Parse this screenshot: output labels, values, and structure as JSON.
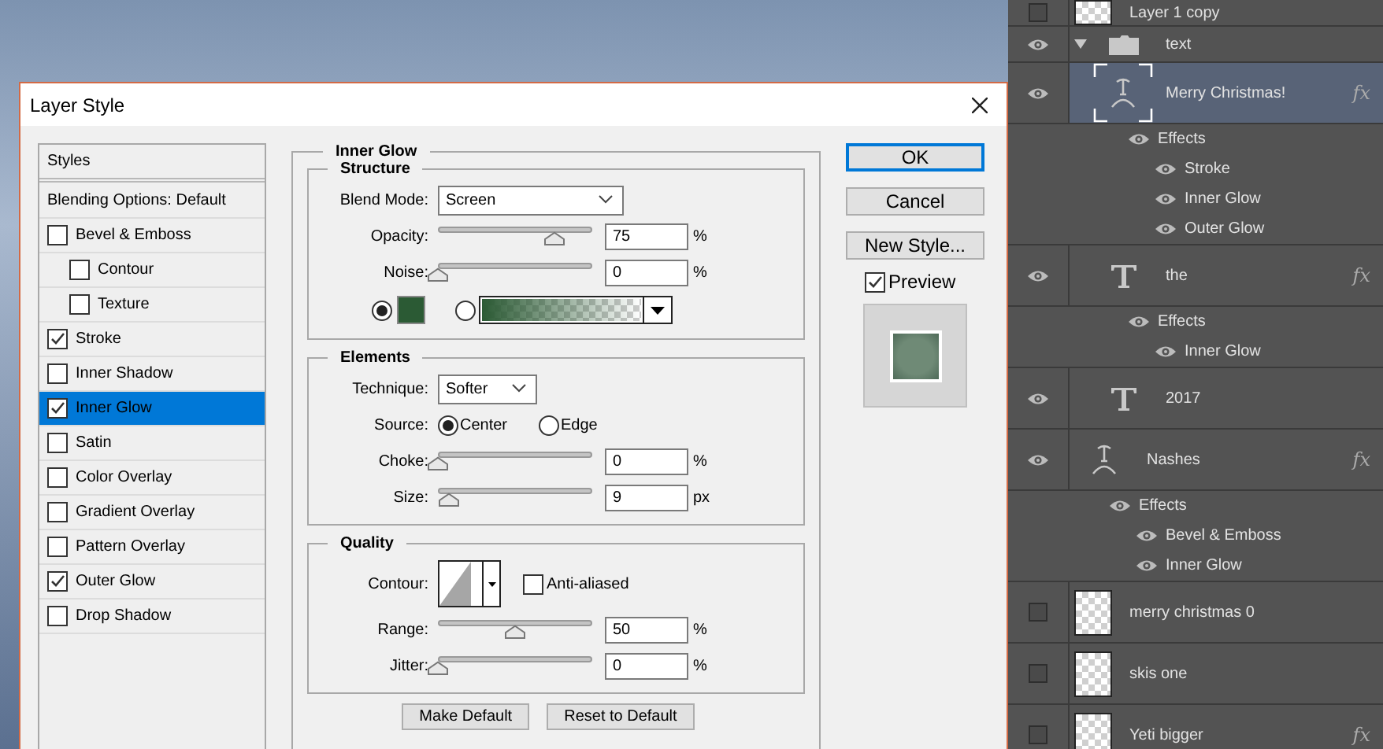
{
  "dialog": {
    "title": "Layer Style",
    "styles": [
      {
        "label": "Styles",
        "kind": "header",
        "selected": false
      },
      {
        "label": "Blending Options: Default",
        "kind": "header",
        "selected": false
      },
      {
        "label": "Bevel & Emboss",
        "kind": "checkbox",
        "checked": false,
        "selected": false,
        "children": [
          {
            "label": "Contour",
            "kind": "checkbox",
            "checked": false,
            "selected": false
          },
          {
            "label": "Texture",
            "kind": "checkbox",
            "checked": false,
            "selected": false
          }
        ]
      },
      {
        "label": "Stroke",
        "kind": "checkbox",
        "checked": true,
        "selected": false
      },
      {
        "label": "Inner Shadow",
        "kind": "checkbox",
        "checked": false,
        "selected": false
      },
      {
        "label": "Inner Glow",
        "kind": "checkbox",
        "checked": true,
        "selected": true
      },
      {
        "label": "Satin",
        "kind": "checkbox",
        "checked": false,
        "selected": false
      },
      {
        "label": "Color Overlay",
        "kind": "checkbox",
        "checked": false,
        "selected": false
      },
      {
        "label": "Gradient Overlay",
        "kind": "checkbox",
        "checked": false,
        "selected": false
      },
      {
        "label": "Pattern Overlay",
        "kind": "checkbox",
        "checked": false,
        "selected": false
      },
      {
        "label": "Outer Glow",
        "kind": "checkbox",
        "checked": true,
        "selected": false
      },
      {
        "label": "Drop Shadow",
        "kind": "checkbox",
        "checked": false,
        "selected": false
      }
    ],
    "panel": {
      "title": "Inner Glow",
      "structure": {
        "title": "Structure",
        "blend_mode": {
          "label": "Blend Mode:",
          "value": "Screen"
        },
        "sliders": [
          {
            "label": "Opacity:",
            "level": 0.75,
            "value": "75",
            "unit": "%"
          },
          {
            "label": "Noise:",
            "level": 0,
            "value": "0",
            "unit": "%"
          }
        ],
        "fill": [
          {
            "kind": "color",
            "selected": true,
            "color": "#2b5a34"
          },
          {
            "kind": "gradient",
            "selected": false,
            "color": "#2b5a34"
          }
        ]
      },
      "elements": {
        "title": "Elements",
        "technique": {
          "label": "Technique:",
          "value": "Softer"
        },
        "source": {
          "label": "Source:",
          "options": [
            {
              "label": "Center",
              "selected": true
            },
            {
              "label": "Edge",
              "selected": false
            }
          ]
        },
        "sliders": [
          {
            "label": "Choke:",
            "level": 0,
            "value": "0",
            "unit": "%"
          },
          {
            "label": "Size:",
            "level": 0.07,
            "value": "9",
            "unit": "px"
          }
        ]
      },
      "quality": {
        "title": "Quality",
        "contour": {
          "label": "Contour:"
        },
        "anti_aliased": {
          "label": "Anti-aliased",
          "checked": false
        },
        "sliders": [
          {
            "label": "Range:",
            "level": 0.5,
            "value": "50",
            "unit": "%"
          },
          {
            "label": "Jitter:",
            "level": 0,
            "value": "0",
            "unit": "%"
          }
        ]
      },
      "buttons": [
        "Make Default",
        "Reset to Default"
      ]
    },
    "actions": [
      {
        "label": "OK",
        "default": true
      },
      {
        "label": "Cancel",
        "default": false
      },
      {
        "label": "New Style...",
        "default": false
      }
    ],
    "preview": {
      "label": "Preview",
      "checked": true
    }
  },
  "layers": [
    {
      "name": "Layer 1 copy",
      "kind": "image",
      "visible": false,
      "selected": false
    },
    {
      "name": "text",
      "kind": "group",
      "visible": true,
      "selected": false,
      "expanded": true,
      "children": [
        {
          "name": "Merry Christmas!",
          "kind": "warp-text",
          "visible": true,
          "selected": true,
          "badge": "fx",
          "effects": {
            "label": "Effects",
            "visible": true,
            "items": [
              {
                "name": "Stroke",
                "visible": true
              },
              {
                "name": "Inner Glow",
                "visible": true
              },
              {
                "name": "Outer Glow",
                "visible": true
              }
            ]
          }
        },
        {
          "name": "the",
          "kind": "text",
          "visible": true,
          "selected": false,
          "badge": "fx",
          "effects": {
            "label": "Effects",
            "visible": true,
            "items": [
              {
                "name": "Inner Glow",
                "visible": true
              }
            ]
          }
        },
        {
          "name": "2017",
          "kind": "text",
          "visible": true,
          "selected": false
        }
      ]
    },
    {
      "name": "Nashes",
      "kind": "warp-text",
      "visible": true,
      "selected": false,
      "badge": "fx",
      "effects": {
        "label": "Effects",
        "visible": true,
        "items": [
          {
            "name": "Bevel & Emboss",
            "visible": true
          },
          {
            "name": "Inner Glow",
            "visible": true
          }
        ]
      }
    },
    {
      "name": "merry christmas 0",
      "kind": "image",
      "visible": false,
      "selected": false
    },
    {
      "name": "skis one",
      "kind": "image",
      "visible": false,
      "selected": false
    },
    {
      "name": "Yeti bigger",
      "kind": "image",
      "visible": false,
      "selected": false,
      "badge": "fx"
    }
  ]
}
